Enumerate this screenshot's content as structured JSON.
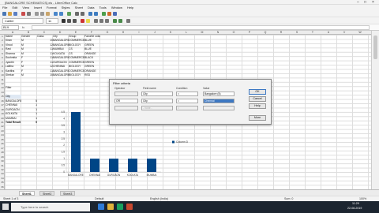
{
  "window": {
    "title": "[BANGALORE SCHEMATICS].xls - LibreOffice Calc"
  },
  "menu": [
    "File",
    "Edit",
    "View",
    "Insert",
    "Format",
    "Styles",
    "Sheet",
    "Data",
    "Tools",
    "Window",
    "Help"
  ],
  "toolbar": {
    "font_name": "Calibri",
    "font_size": "11"
  },
  "formula_bar": {
    "cell_ref": "B19",
    "fx": "fx"
  },
  "columns": [
    "A",
    "B",
    "C",
    "D",
    "E",
    "F",
    "G",
    "H",
    "I",
    "J",
    "K",
    "L",
    "M",
    "N",
    "O",
    "P",
    "Q",
    "R",
    "S",
    "T",
    "U",
    "V",
    "W"
  ],
  "rows": [
    "1",
    "2",
    "3",
    "4",
    "5",
    "6",
    "7",
    "8",
    "9",
    "10",
    "11",
    "12",
    "13",
    "14",
    "15",
    "16",
    "17",
    "18",
    "19",
    "20",
    "21",
    "22",
    "23",
    "24",
    "25",
    "26",
    "27",
    "28",
    "29",
    "30",
    "31",
    "32",
    "33",
    "34",
    "35",
    "36"
  ],
  "sheet": {
    "headers": [
      "Name",
      "Gender",
      "Class",
      "City",
      "Group",
      "Favorite color"
    ],
    "records": [
      [
        "Kiran",
        "M",
        "10",
        "BANGALORE",
        "COMMERCE",
        "BLUE"
      ],
      [
        "Vinod",
        "M",
        "12",
        "BANGALORE",
        "BIOLOGY",
        "GREEN"
      ],
      [
        "Ravi",
        "M",
        "11",
        "MUMBAI",
        "CS",
        "BLUE"
      ],
      [
        "Sharma",
        "M",
        "11",
        "KOLKATA",
        "CS",
        "ORANGE"
      ],
      [
        "Sushmita",
        "F",
        "11",
        "BANGALORE",
        "COMMERCE",
        "BLACK"
      ],
      [
        "Jyanthi",
        "F",
        "11",
        "GURGAON",
        "COMMERCE",
        "GREEN"
      ],
      [
        "Lalitha",
        "M",
        "12",
        "CHENNAI",
        "BIOLOGY",
        "GREEN"
      ],
      [
        "Kavitha",
        "F",
        "11",
        "BANGALORE",
        "COMMERCE",
        "ORANGE"
      ],
      [
        "Shekar",
        "M",
        "10",
        "BANGALORE",
        "BIOLOGY",
        "RED"
      ]
    ],
    "pivot": {
      "filter_label": "Filter",
      "row_label": "City",
      "rows": [
        [
          "BANGALORE",
          "5"
        ],
        [
          "CHENNAI",
          "1"
        ],
        [
          "GURGAON",
          "1"
        ],
        [
          "KOLKATA",
          "1"
        ],
        [
          "MUMBAI",
          "1"
        ]
      ],
      "total_label": "Total Result",
      "total_value": "9"
    }
  },
  "dialog": {
    "title": "Filter criteria",
    "col_operator": "Operator",
    "col_field": "Field name",
    "col_condition": "Condition",
    "col_value": "Value",
    "rows": [
      {
        "operator": "",
        "field": "City",
        "condition": "=",
        "value": "Bangalore (5)"
      },
      {
        "operator": "OR",
        "field": "City",
        "condition": "=",
        "value": "Chennai"
      },
      {
        "operator": "",
        "field": "- none -",
        "condition": "=",
        "value": ""
      }
    ],
    "btn_ok": "OK",
    "btn_cancel": "Cancel",
    "btn_help": "Help",
    "btn_more": "More"
  },
  "chart_data": {
    "type": "bar",
    "categories": [
      "BANGALORE",
      "CHENNAI",
      "GURGAON",
      "KOLKATA",
      "MUMBAI"
    ],
    "series": [
      {
        "name": "Column D",
        "values": [
          5,
          1,
          1,
          1,
          1
        ]
      }
    ],
    "ylim": [
      0,
      4.5
    ],
    "yticks": [
      "0",
      "0.5",
      "1",
      "1.5",
      "2",
      "2.5",
      "3",
      "3.5",
      "4",
      "4.5"
    ],
    "legend": "right",
    "grid": false,
    "bar_color": "#004586"
  },
  "sheet_tabs": [
    "Sheet1",
    "Sheet2",
    "Sheet3"
  ],
  "status": {
    "sheet_pos": "Sheet 1 of 3",
    "style": "Default",
    "lang": "English (India)",
    "sum": "Sum: 0",
    "zoom": "100%"
  },
  "taskbar": {
    "search_placeholder": "Type here to search",
    "time": "11:29",
    "date": "22-08-2019"
  }
}
